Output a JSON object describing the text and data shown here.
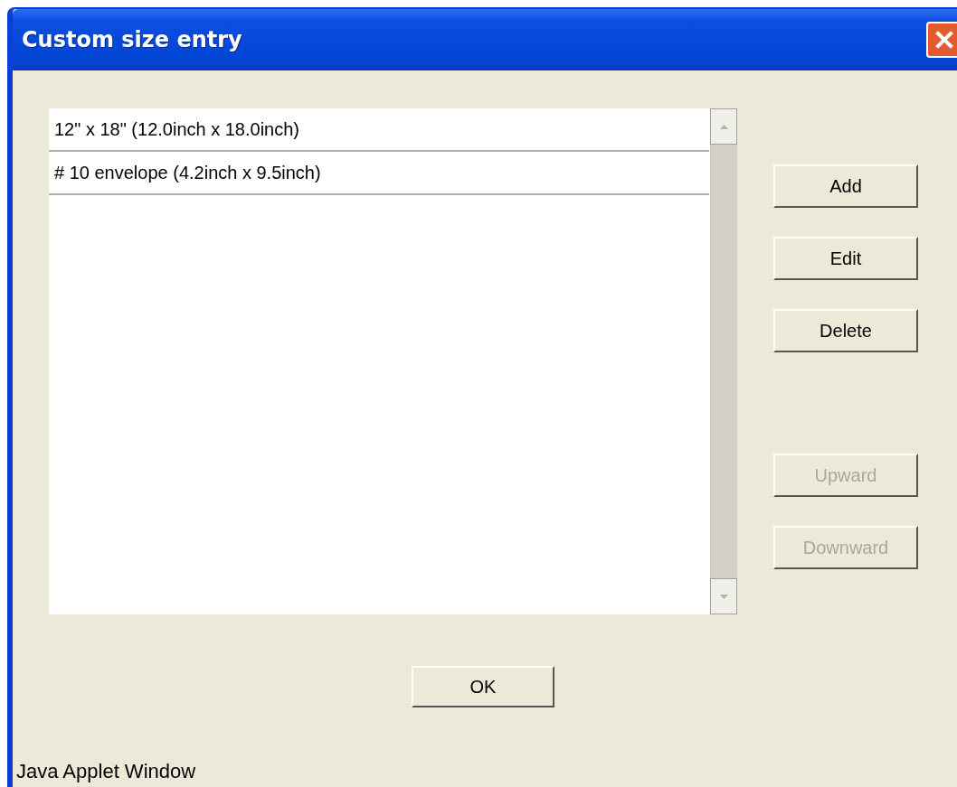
{
  "window": {
    "title": "Custom size entry"
  },
  "list": {
    "items": [
      {
        "label": "12\" x 18\" (12.0inch x 18.0inch)",
        "selected": false
      },
      {
        "label": "# 10 envelope (4.2inch x 9.5inch)",
        "selected": false
      }
    ]
  },
  "side_buttons": [
    {
      "label": "Add",
      "disabled": false
    },
    {
      "label": "Edit",
      "disabled": false
    },
    {
      "label": "Delete",
      "disabled": false
    },
    {
      "label": "Upward",
      "disabled": true
    },
    {
      "label": "Downward",
      "disabled": true
    }
  ],
  "ok_button": {
    "label": "OK"
  },
  "status_bar": {
    "text": "Java Applet Window"
  }
}
